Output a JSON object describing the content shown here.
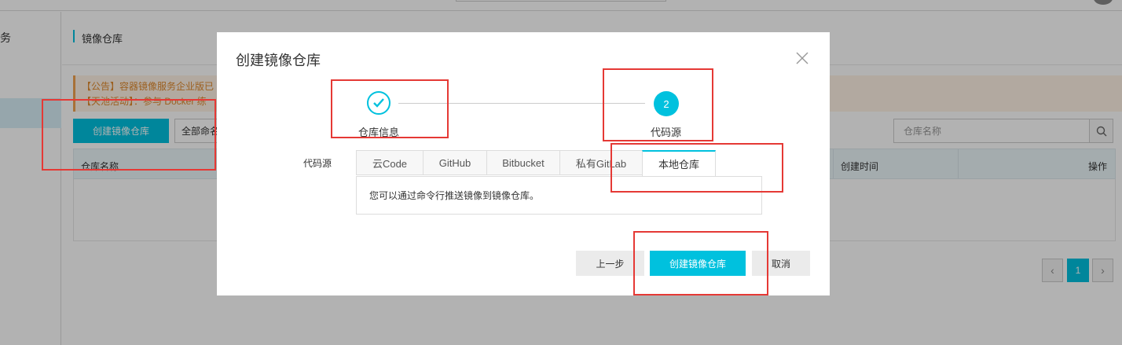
{
  "sidebar": {
    "title_fragment": "务"
  },
  "page": {
    "title": "镜像仓库",
    "notices": [
      "【公告】容器镜像服务企业版已",
      "【天池活动】：参与 Docker 练"
    ],
    "create_button": "创建镜像仓库",
    "namespace_select": "全部命名",
    "search_placeholder": "仓库名称",
    "table_headers": {
      "name": "仓库名称",
      "created": "创建时间",
      "actions": "操作"
    },
    "pager": {
      "current": "1",
      "prev_symbol": "‹",
      "next_symbol": "›"
    }
  },
  "dialog": {
    "title": "创建镜像仓库",
    "close_symbol": "×",
    "steps": [
      {
        "label": "仓库信息",
        "state": "done"
      },
      {
        "label": "代码源",
        "state": "current",
        "number": "2"
      }
    ],
    "source_label": "代码源",
    "tabs": [
      {
        "label": "云Code"
      },
      {
        "label": "GitHub"
      },
      {
        "label": "Bitbucket"
      },
      {
        "label": "私有GitLab"
      },
      {
        "label": "本地仓库",
        "active": true
      }
    ],
    "tab_content": "您可以通过命令行推送镜像到镜像仓库。",
    "buttons": {
      "prev": "上一步",
      "create": "创建镜像仓库",
      "cancel": "取消"
    }
  },
  "colors": {
    "accent": "#00c1de",
    "highlight": "#e53935",
    "notice_bg": "#fff3e6"
  },
  "icons": [
    "check-icon",
    "close-icon",
    "search-icon",
    "chevron-left-icon",
    "chevron-right-icon"
  ]
}
